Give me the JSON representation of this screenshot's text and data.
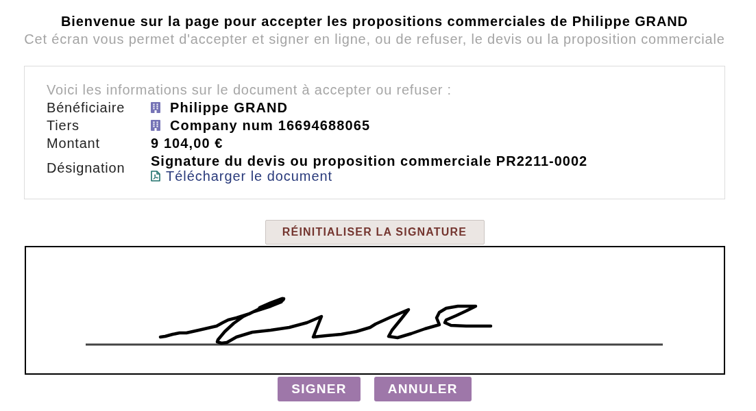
{
  "header": {
    "title": "Bienvenue sur la page pour accepter les propositions commerciales de Philippe GRAND",
    "subtitle": "Cet écran vous permet d'accepter et signer en ligne, ou de refuser, le devis ou la proposition commerciale"
  },
  "document_info": {
    "intro": "Voici les informations sur le document à accepter ou refuser :",
    "fields": [
      {
        "label": "Bénéficiaire",
        "kind": "company",
        "value": "Philippe GRAND"
      },
      {
        "label": "Tiers",
        "kind": "company",
        "value": "Company num 16694688065"
      },
      {
        "label": "Montant",
        "kind": "plain",
        "value": "9 104,00 €"
      },
      {
        "label": "Désignation",
        "kind": "document",
        "value": "Signature du devis ou proposition commerciale PR2211-0002",
        "link": "Télécharger le document"
      }
    ]
  },
  "reset_button": {
    "label": "RÉINITIALISER LA SIGNATURE"
  },
  "signature_pad": {
    "signed": true
  },
  "buttons": [
    {
      "label": "SIGNER"
    },
    {
      "label": "ANNULER"
    }
  ]
}
